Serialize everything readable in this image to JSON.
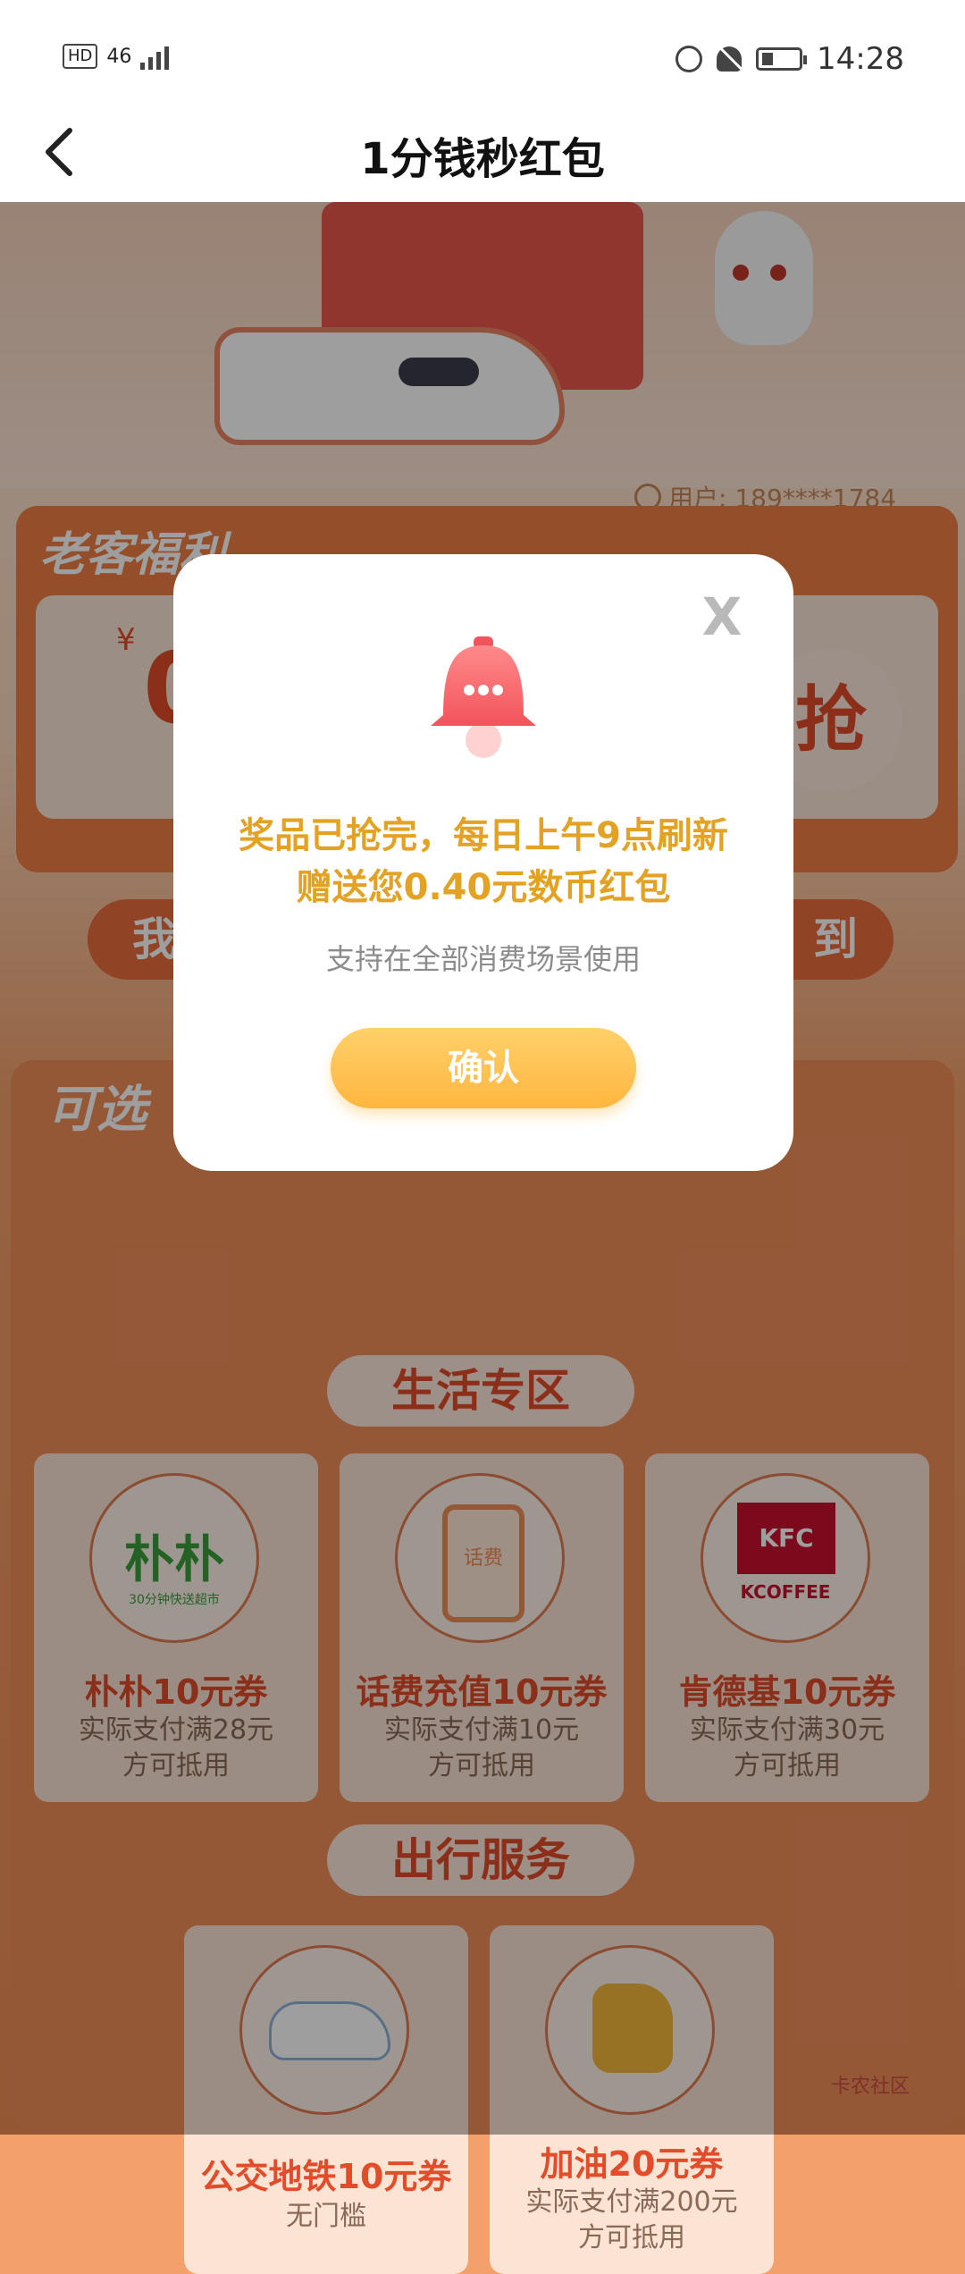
{
  "status_bar": {
    "left_hd": "HD",
    "left_network": "46",
    "time": "14:28",
    "icons": [
      "alarm-icon",
      "mute-icon",
      "battery-icon"
    ]
  },
  "nav": {
    "back_icon": "chevron-left-icon",
    "title": "1分钱秒红包"
  },
  "background": {
    "user_label": "用户: 189****1784",
    "old_customer_tag": "老客福利",
    "coupon_yen": "¥",
    "coupon_digit": "0",
    "grab_label": "抢",
    "pill_left_char": "我",
    "pill_right_char": "到",
    "optional_tag": "可选",
    "life_section_title": "生活专区",
    "travel_section_title": "出行服务",
    "life_tiles": [
      {
        "icon": "pupu-logo-icon",
        "logo_text": "朴朴",
        "logo_sub": "30分钟快送超市",
        "name": "朴朴10元券",
        "desc1": "实际支付满28元",
        "desc2": "方可抵用"
      },
      {
        "icon": "phone-icon",
        "phone_text": "话费",
        "name": "话费充值10元券",
        "desc1": "实际支付满10元",
        "desc2": "方可抵用"
      },
      {
        "icon": "kfc-logo-icon",
        "logo_text": "KFC",
        "logo_sub": "KCOFFEE",
        "name": "肯德基10元券",
        "desc1": "实际支付满30元",
        "desc2": "方可抵用"
      }
    ],
    "travel_tiles": [
      {
        "icon": "train-icon",
        "name": "公交地铁10元券",
        "desc1": "无门槛"
      },
      {
        "icon": "fuel-nozzle-icon",
        "name": "加油20元券",
        "desc1": "实际支付满200元",
        "desc2": "方可抵用"
      }
    ],
    "watermark": "卡农社区"
  },
  "modal": {
    "close_label": "X",
    "bell_icon": "bell-icon",
    "message_line1": "奖品已抢完，每日上午9点刷新",
    "message_line2": "赠送您0.40元数币红包",
    "subtext": "支持在全部消费场景使用",
    "confirm_label": "确认"
  },
  "colors": {
    "accent_red": "#e24c2a",
    "modal_text_gold": "#e3a224",
    "confirm_button": "#ffc34f"
  }
}
